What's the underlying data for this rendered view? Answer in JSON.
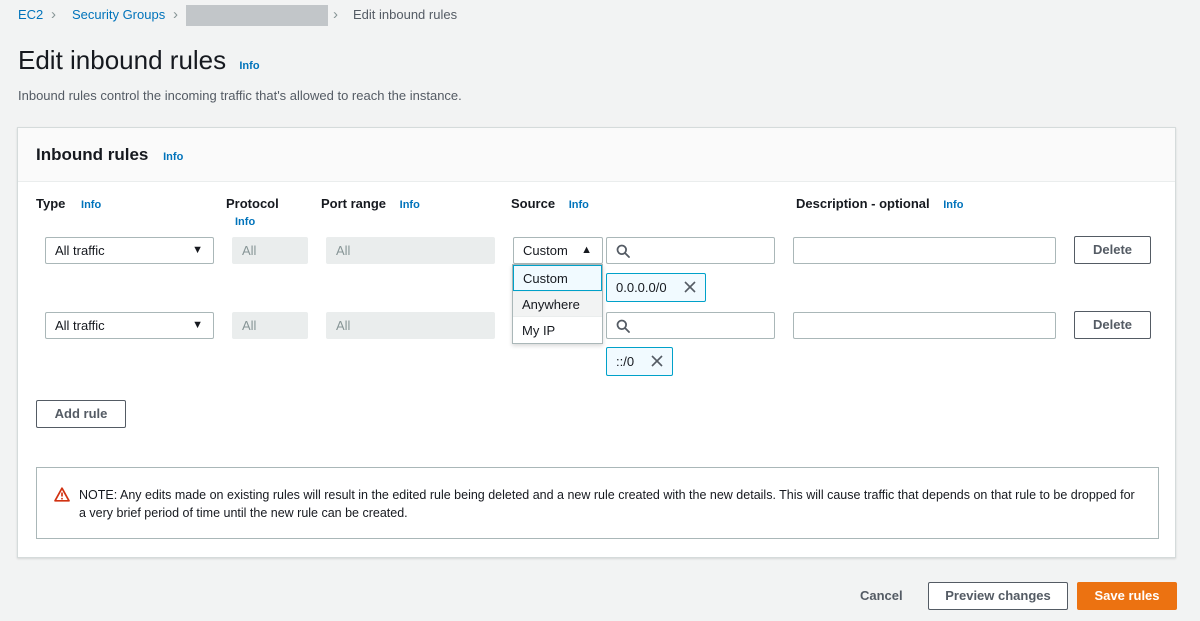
{
  "breadcrumb": {
    "items": [
      "EC2",
      "Security Groups",
      "Edit inbound rules"
    ],
    "separator": ">"
  },
  "header": {
    "title": "Edit inbound rules",
    "info": "Info",
    "description": "Inbound rules control the incoming traffic that's allowed to reach the instance."
  },
  "panel": {
    "title": "Inbound rules",
    "info": "Info",
    "columns": {
      "type": "Type",
      "protocol": "Protocol",
      "port_range": "Port range",
      "source": "Source",
      "description": "Description - optional",
      "info": "Info"
    },
    "rules": [
      {
        "type": "All traffic",
        "protocol": "All",
        "port_range": "All",
        "source": "Custom",
        "token": "0.0.0.0/0",
        "delete": "Delete"
      },
      {
        "type": "All traffic",
        "protocol": "All",
        "port_range": "All",
        "token": "::/0",
        "delete": "Delete"
      }
    ],
    "source_options": [
      "Custom",
      "Anywhere",
      "My IP"
    ],
    "add_rule": "Add rule",
    "notice": "NOTE: Any edits made on existing rules will result in the edited rule being deleted and a new rule created with the new details. This will cause traffic that depends on that rule to be dropped for a very brief period of time until the new rule can be created."
  },
  "footer": {
    "cancel": "Cancel",
    "preview": "Preview changes",
    "save": "Save rules"
  },
  "colors": {
    "link": "#0073bb",
    "primary": "#ec7211",
    "warning": "#d13212",
    "token_border": "#00a1c9"
  }
}
